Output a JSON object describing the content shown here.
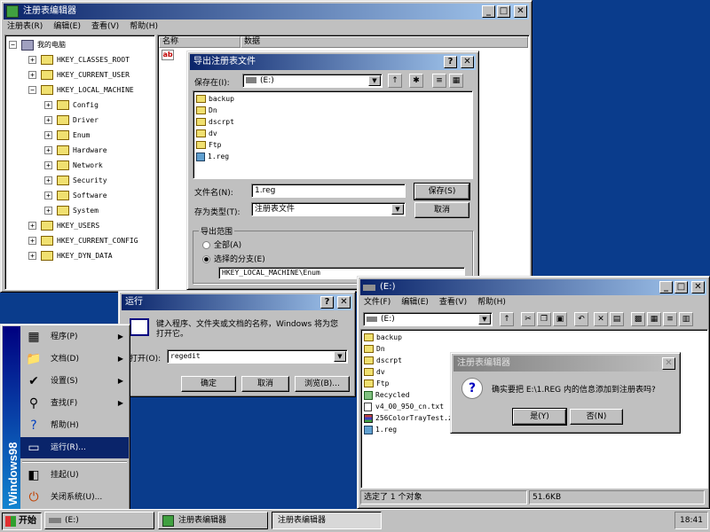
{
  "regedit_main": {
    "title": "注册表编辑器",
    "menu": [
      "注册表(R)",
      "编辑(E)",
      "查看(V)",
      "帮助(H)"
    ],
    "col_name": "名称",
    "col_data": "数据",
    "tree": [
      {
        "label": "我的电脑",
        "expander": "−"
      },
      {
        "label": "HKEY_CLASSES_ROOT",
        "expander": "+"
      },
      {
        "label": "HKEY_CURRENT_USER",
        "expander": "+"
      },
      {
        "label": "HKEY_LOCAL_MACHINE",
        "expander": "−"
      },
      {
        "label": "Config",
        "expander": "+"
      },
      {
        "label": "Driver",
        "expander": "+"
      },
      {
        "label": "Enum",
        "expander": "+"
      },
      {
        "label": "Hardware",
        "expander": "+"
      },
      {
        "label": "Network",
        "expander": "+"
      },
      {
        "label": "Security",
        "expander": "+"
      },
      {
        "label": "Software",
        "expander": "+"
      },
      {
        "label": "System",
        "expander": "+"
      },
      {
        "label": "HKEY_USERS",
        "expander": "+"
      },
      {
        "label": "HKEY_CURRENT_CONFIG",
        "expander": "+"
      },
      {
        "label": "HKEY_DYN_DATA",
        "expander": "+"
      }
    ],
    "value_icon": "ab"
  },
  "export_dialog": {
    "title": "导出注册表文件",
    "save_in_label": "保存在(I):",
    "save_in_value": "(E:)",
    "files": [
      "backup",
      "Dn",
      "dscrpt",
      "dv",
      "Ftp",
      "1.reg"
    ],
    "filename_label": "文件名(N):",
    "filename_value": "1.reg",
    "filetype_label": "存为类型(T):",
    "filetype_value": "注册表文件",
    "save_button": "保存(S)",
    "cancel_button": "取消",
    "range_group": "导出范围",
    "range_all": "全部(A)",
    "range_selected": "选择的分支(E)",
    "branch_value": "HKEY_LOCAL_MACHINE\\Enum"
  },
  "run_dialog": {
    "title": "运行",
    "prompt": "键入程序、文件夹或文档的名称，Windows 将为您打开它。",
    "open_label": "打开(O):",
    "open_value": "regedit",
    "ok_button": "确定",
    "cancel_button": "取消",
    "browse_button": "浏览(B)..."
  },
  "explorer": {
    "title": "(E:)",
    "menu": [
      "文件(F)",
      "编辑(E)",
      "查看(V)",
      "帮助(H)"
    ],
    "address_value": "(E:)",
    "files": [
      "backup",
      "Dn",
      "dscrpt",
      "dv",
      "Ftp",
      "Recycled",
      "v4_00_950_cn.txt",
      "256ColorTrayTest.zi",
      "1.reg"
    ],
    "status_left": "选定了 1 个对象",
    "status_right": "51.6KB"
  },
  "confirm_dialog": {
    "title": "注册表编辑器",
    "message": "确实要把 E:\\1.REG 内的信息添加到注册表吗?",
    "yes_button": "是(Y)",
    "no_button": "否(N)"
  },
  "start_menu": {
    "banner": "Windows98",
    "items": [
      {
        "label": "程序(P)",
        "icon": "programs-icon",
        "submenu": true
      },
      {
        "label": "文档(D)",
        "icon": "documents-icon",
        "submenu": true
      },
      {
        "label": "设置(S)",
        "icon": "settings-icon",
        "submenu": true
      },
      {
        "label": "查找(F)",
        "icon": "find-icon",
        "submenu": true
      },
      {
        "label": "帮助(H)",
        "icon": "help-icon",
        "submenu": false
      },
      {
        "label": "运行(R)...",
        "icon": "run-icon",
        "submenu": false
      },
      {
        "label": "挂起(U)",
        "icon": "suspend-icon",
        "submenu": false
      },
      {
        "label": "关闭系统(U)...",
        "icon": "shutdown-icon",
        "submenu": false
      }
    ]
  },
  "taskbar": {
    "start_label": "开始",
    "tasks": [
      "(E:)",
      "注册表编辑器",
      "注册表编辑器"
    ],
    "clock": "18:41"
  }
}
